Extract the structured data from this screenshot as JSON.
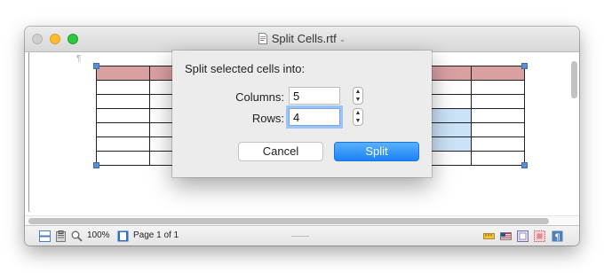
{
  "window": {
    "title": "Split Cells.rtf"
  },
  "document": {
    "paragraph_mark": "¶"
  },
  "dialog": {
    "heading": "Split selected cells into:",
    "columns_label": "Columns:",
    "columns_value": "5",
    "rows_label": "Rows:",
    "rows_value": "4",
    "cancel_label": "Cancel",
    "split_label": "Split"
  },
  "statusbar": {
    "zoom": "100%",
    "page": "Page 1 of 1"
  },
  "colors": {
    "header_row": "#d9a0a2",
    "selected_cells": "#cbe3f8",
    "accent": "#1a82f7"
  },
  "icons": [
    "doc-icon",
    "stepper-up-icon",
    "stepper-down-icon",
    "layout-icon",
    "clipboard-icon",
    "magnifier-icon",
    "page-view-icon",
    "ruler-icon",
    "flag-icon",
    "frame-icon",
    "stamp-icon",
    "pilcrow-icon"
  ]
}
